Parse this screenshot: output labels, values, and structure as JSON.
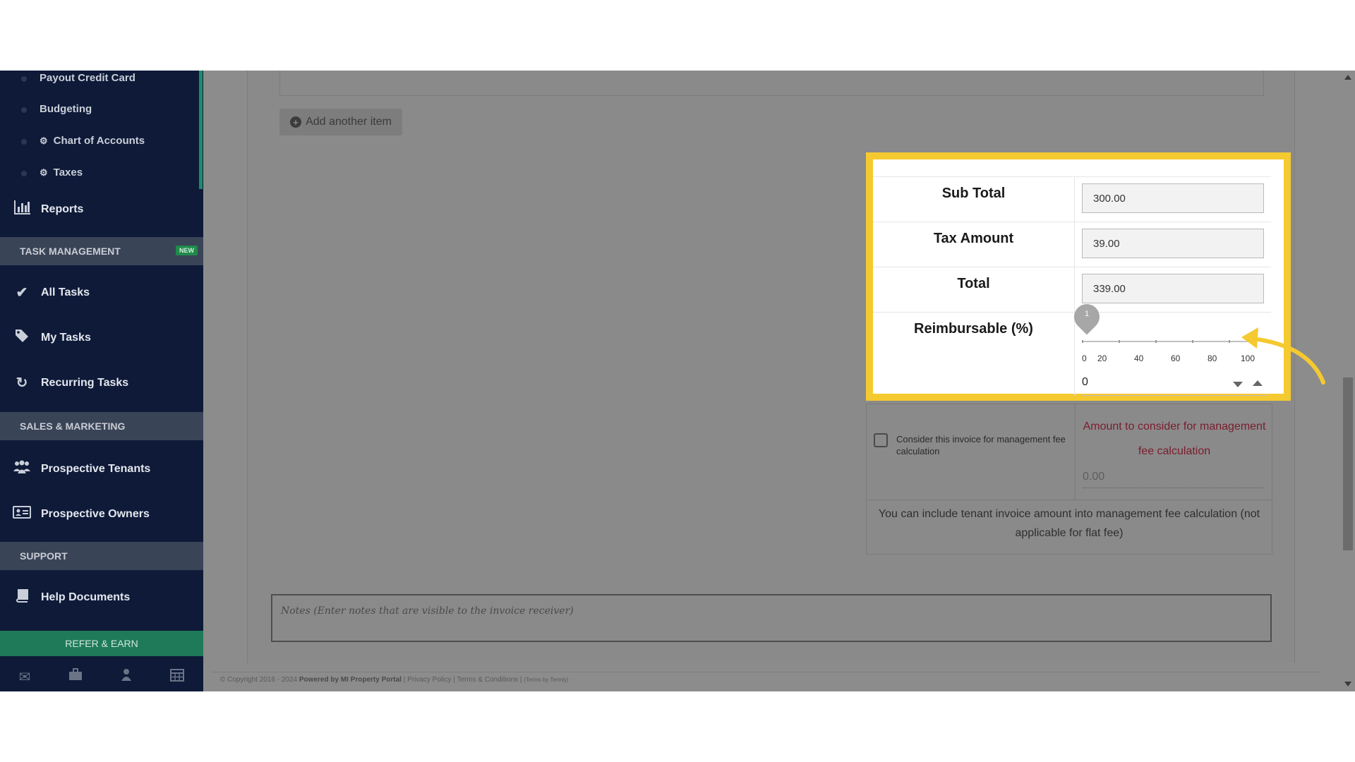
{
  "sidebar": {
    "sub_items": [
      {
        "label": "Payout Credit Card",
        "icon": ""
      },
      {
        "label": "Budgeting",
        "icon": ""
      },
      {
        "label": "Chart of Accounts",
        "icon": "gear-icon"
      },
      {
        "label": "Taxes",
        "icon": "gear-icon"
      }
    ],
    "reports": "Reports",
    "task_section": "TASK MANAGEMENT",
    "new_badge": "NEW",
    "all_tasks": "All Tasks",
    "my_tasks": "My Tasks",
    "recurring_tasks": "Recurring Tasks",
    "sales_section": "SALES & MARKETING",
    "prospective_tenants": "Prospective Tenants",
    "prospective_owners": "Prospective Owners",
    "support_section": "SUPPORT",
    "help_documents": "Help Documents",
    "refer_earn": "REFER & EARN"
  },
  "main": {
    "add_item_label": "Add another item",
    "totals": {
      "subtotal_label": "Sub Total",
      "subtotal_value": "300.00",
      "tax_label": "Tax Amount",
      "tax_value": "39.00",
      "total_label": "Total",
      "total_value": "339.00",
      "reimbursable_label": "Reimbursable (%)",
      "slider_handle_value": "1",
      "slider_ticks": [
        "0",
        "20",
        "40",
        "60",
        "80",
        "100"
      ],
      "reimbursable_value": "0"
    },
    "fee": {
      "checkbox_label": "Consider this invoice for management fee calculation",
      "amount_label": "Amount to consider for management fee calculation",
      "amount_value": "0.00",
      "note": "You can include tenant invoice amount into management fee calculation (not applicable for flat fee)"
    },
    "notes_placeholder": "Notes (Enter notes that are visible to the invoice receiver)"
  },
  "footer": {
    "copyright": "© Copyright 2016 - 2024",
    "powered": "Powered by MI Property Portal",
    "privacy": "Privacy Policy",
    "terms": "Terms & Conditions",
    "termly": "(Terms by Termly)"
  },
  "colors": {
    "sidebar_bg": "#0e1a38",
    "highlight": "#f5c930",
    "refer_bg": "#1f7a5a",
    "fee_red": "#7a1d2d"
  }
}
